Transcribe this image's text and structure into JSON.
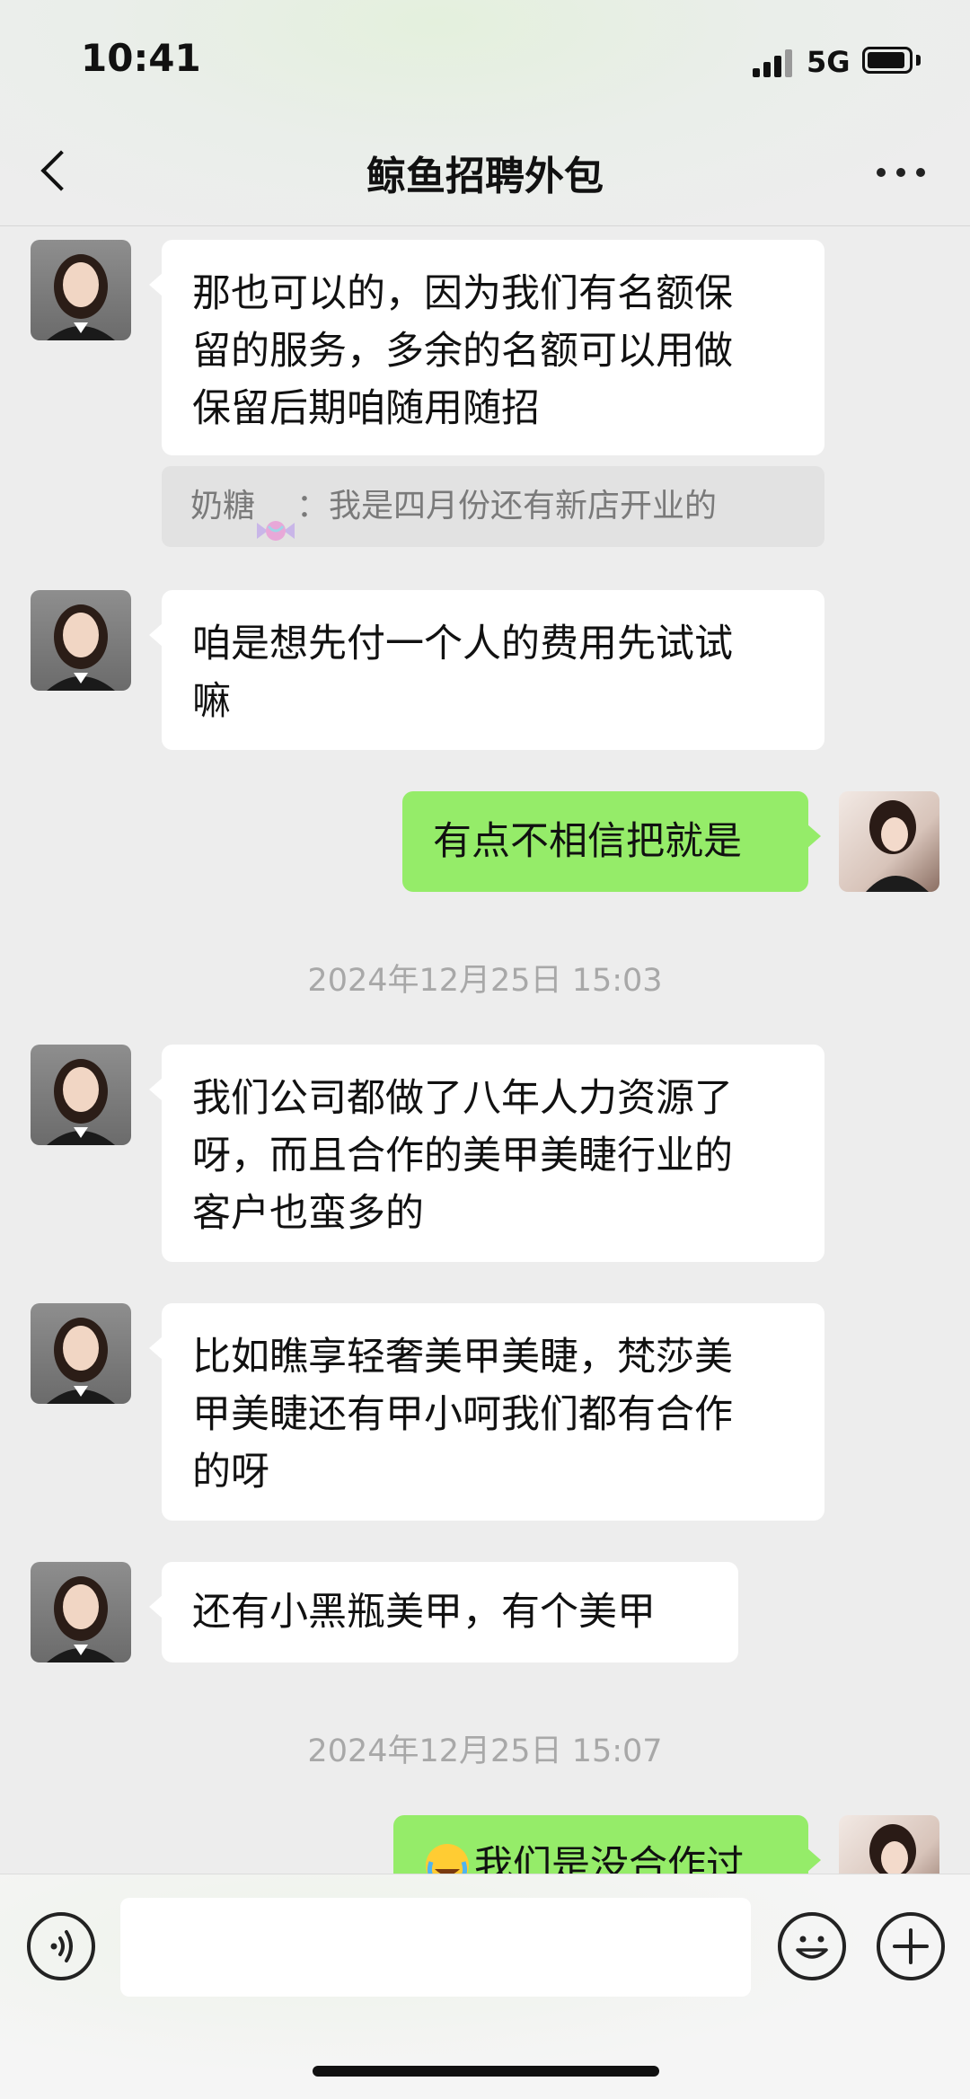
{
  "status_bar": {
    "time": "10:41",
    "network": "5G",
    "icons": [
      "signal-icon",
      "battery-icon"
    ]
  },
  "header": {
    "title": "鲸鱼招聘外包",
    "back_icon": "chevron-left-icon",
    "more_icon": "more-dots-icon"
  },
  "messages": [
    {
      "side": "left",
      "text": [
        "那也可以的，因为我们有名额保",
        "留的服务，多余的名额可以用做",
        "保留后期咱随用随招"
      ]
    },
    {
      "type": "quote",
      "sender": "奶糖",
      "text": "：我是四月份还有新店开业的"
    },
    {
      "side": "left",
      "text": [
        "咱是想先付一个人的费用先试试",
        "嘛"
      ]
    },
    {
      "side": "right",
      "text": [
        "有点不相信把就是"
      ]
    },
    {
      "type": "timestamp",
      "text": "2024年12月25日 15:03"
    },
    {
      "side": "left",
      "text": [
        "我们公司都做了八年人力资源了",
        "呀，而且合作的美甲美睫行业的",
        "客户也蛮多的"
      ]
    },
    {
      "side": "left",
      "text": [
        "比如瞧享轻奢美甲美睫，梵莎美",
        "甲美睫还有甲小呵我们都有合作",
        "的呀"
      ]
    },
    {
      "side": "left",
      "text": [
        "还有小黑瓶美甲，有个美甲"
      ]
    },
    {
      "type": "timestamp",
      "text": "2024年12月25日 15:07"
    },
    {
      "side": "right",
      "text": [
        "我们是没合作过"
      ],
      "emoji": "crying-laughing-emoji"
    }
  ],
  "input_bar": {
    "placeholder": "",
    "icons": [
      "voice-icon",
      "emoji-icon",
      "plus-icon"
    ]
  },
  "colors": {
    "chat_bg": "#ededed",
    "bubble_self": "#95ec69",
    "bubble_other": "#ffffff",
    "timestamp": "#a8a8a8"
  }
}
